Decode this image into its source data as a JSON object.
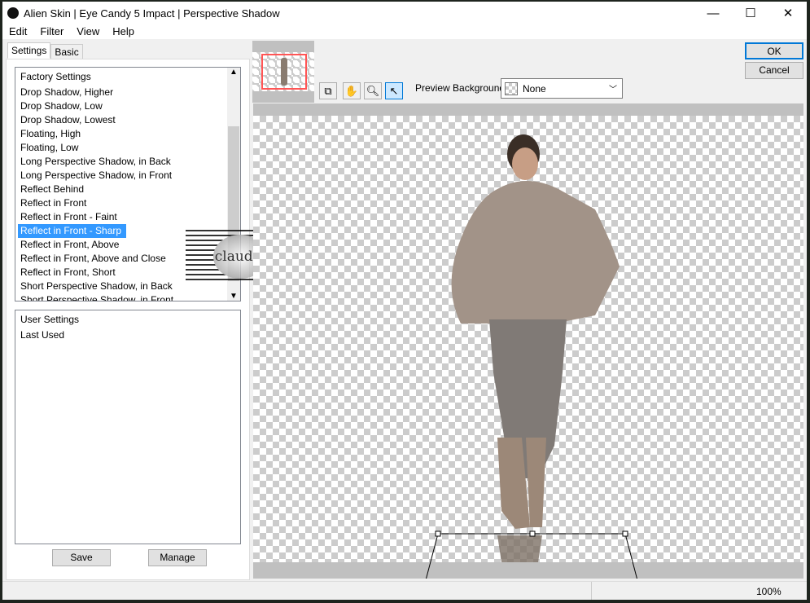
{
  "window": {
    "title": "Alien Skin | Eye Candy 5 Impact | Perspective Shadow",
    "minimize": "—",
    "maximize": "☐",
    "close": "✕"
  },
  "menu": [
    "Edit",
    "Filter",
    "View",
    "Help"
  ],
  "tabs": [
    "Settings",
    "Basic"
  ],
  "factory": {
    "header": "Factory Settings",
    "items": [
      "Drop Shadow, Higher",
      "Drop Shadow, Low",
      "Drop Shadow, Lowest",
      "Floating, High",
      "Floating, Low",
      "Long Perspective Shadow, in Back",
      "Long Perspective Shadow, in Front",
      "Reflect Behind",
      "Reflect in Front",
      "Reflect in Front - Faint",
      "Reflect in Front - Sharp",
      "Reflect in Front, Above",
      "Reflect in Front, Above and Close",
      "Reflect in Front, Short",
      "Short Perspective Shadow, in Back",
      "Short Perspective Shadow, in Front"
    ],
    "selected": "Reflect in Front - Sharp"
  },
  "user": {
    "header": "User Settings",
    "items": [
      "Last Used"
    ]
  },
  "buttons": {
    "save": "Save",
    "manage": "Manage",
    "ok": "OK",
    "cancel": "Cancel"
  },
  "toolbar": {
    "preview_bg_label": "Preview Background:",
    "preview_bg_value": "None",
    "icons": [
      "preview-toggle-icon",
      "hand-icon",
      "zoom-icon",
      "pointer-icon"
    ]
  },
  "watermark": "claudia",
  "status": {
    "zoom": "100%"
  },
  "colors": {
    "selection": "#3399ff",
    "ok_border": "#0078d7",
    "frame": "#ff5555"
  }
}
